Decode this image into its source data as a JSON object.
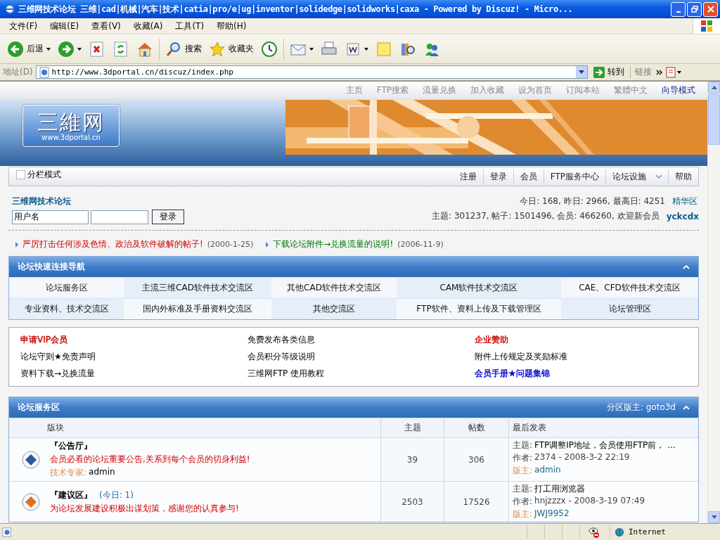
{
  "window": {
    "title": "三维网技术论坛 三维|cad|机械|汽车|技术|catia|pro/e|ug|inventor|solidedge|solidworks|caxa - Powered by Discuz! - Micro..."
  },
  "menu": [
    "文件(F)",
    "编辑(E)",
    "查看(V)",
    "收藏(A)",
    "工具(T)",
    "帮助(H)"
  ],
  "toolbar": [
    {
      "kind": "back",
      "label": "后退",
      "dropdown": true
    },
    {
      "kind": "forward",
      "dropdown": true
    },
    {
      "kind": "stop",
      "dropdown": false
    },
    {
      "kind": "refresh",
      "dropdown": false
    },
    {
      "kind": "home",
      "dropdown": false
    },
    {
      "kind": "search",
      "label": "搜索",
      "dropdown": false
    },
    {
      "kind": "favorites",
      "label": "收藏夹",
      "dropdown": false
    },
    {
      "kind": "history",
      "dropdown": false
    },
    {
      "kind": "mail",
      "dropdown": true
    },
    {
      "kind": "print",
      "dropdown": false
    },
    {
      "kind": "edit",
      "dropdown": true
    },
    {
      "kind": "note",
      "dropdown": false
    },
    {
      "kind": "research",
      "dropdown": false
    },
    {
      "kind": "messenger",
      "dropdown": false
    }
  ],
  "address": {
    "label": "地址(D)",
    "url": "http://www.3dportal.cn/discuz/index.php",
    "go": "转到",
    "links": "链接"
  },
  "top_links": [
    {
      "label": "主页",
      "selected": false
    },
    {
      "label": "FTP搜索",
      "selected": false
    },
    {
      "label": "流量兑换",
      "selected": false
    },
    {
      "label": "加入收藏",
      "selected": false
    },
    {
      "label": "设为首页",
      "selected": false
    },
    {
      "label": "订阅本站",
      "selected": false
    },
    {
      "label": "繁體中文",
      "selected": false
    },
    {
      "label": "向导模式",
      "selected": true
    }
  ],
  "logo": {
    "name": "三維网",
    "url": "www.3dportal.cn"
  },
  "navbar": {
    "split_mode": {
      "label": "分栏模式",
      "checked": false
    },
    "links": [
      {
        "label": "注册",
        "dropdown": false
      },
      {
        "label": "登录",
        "dropdown": false
      },
      {
        "label": "会员",
        "dropdown": false
      },
      {
        "label": "FTP服务中心",
        "dropdown": false
      },
      {
        "label": "论坛设施",
        "dropdown": true
      },
      {
        "label": "帮助",
        "dropdown": false
      }
    ]
  },
  "forum_title": "三维网技术论坛",
  "login": {
    "username": "用户名",
    "button": "登录"
  },
  "stats": [
    {
      "text": "今日: 168, 昨日: 2966, 最高日: 4251",
      "link": "精华区"
    },
    {
      "text": "主题: 301237, 帖子: 1501496, 会员: 466260, 欢迎新会员",
      "link": "yckcdx"
    }
  ],
  "announcements": [
    {
      "text": "严厉打击任何涉及色情、政治及软件破解的帖子!",
      "date": "(2000-1-25)",
      "color": "#cc0000"
    },
    {
      "text": "下载论坛附件→兑换流量的说明!",
      "date": "(2006-11-9)",
      "color": "#007700"
    }
  ],
  "quick_nav": {
    "title": "论坛快速连接导航",
    "items": [
      "论坛服务区",
      "主流三维CAD软件技术交流区",
      "其他CAD软件技术交流区",
      "CAM软件技术交流区",
      "CAE、CFD软件技术交流区",
      "专业资料、技术交流区",
      "国内外标准及手册资料交流区",
      "其他交流区",
      "FTP软件、资料上传及下载管理区",
      "论坛管理区"
    ]
  },
  "links_box": [
    {
      "label": "申请VIP会员",
      "color": "#cc0000"
    },
    {
      "label": "免费发布各类信息"
    },
    {
      "label": "企业赞助",
      "color": "#cc0000"
    },
    {
      "label": "论坛守则★免责声明"
    },
    {
      "label": "会员积分等级说明"
    },
    {
      "label": "附件上传规定及奖励标准"
    },
    {
      "label": "资料下载→兑换流量"
    },
    {
      "label": "三维网FTP 使用教程"
    },
    {
      "label": "会员手册★问题集锦",
      "color": "#0000cc"
    }
  ],
  "forum_section": {
    "title": "论坛服务区",
    "moderator_label": "分区版主:",
    "moderator": "goto3d",
    "columns": [
      "版块",
      "主题",
      "帖数",
      "最后发表"
    ],
    "rows": [
      {
        "color": "#2a5a9a",
        "name": "『公告厅』",
        "desc": "会员必看的论坛重要公告,关系到每个会员的切身利益!",
        "mod_label": "技术专家:",
        "mod": "admin",
        "topics": "39",
        "posts": "306",
        "last": [
          {
            "label": "主题:",
            "value": "FTP调整IP地址，会员使用FTP前， ..."
          },
          {
            "label": "作者:",
            "value": "2374 - 2008-3-2 22:19"
          },
          {
            "label": "版主:",
            "value": "admin"
          }
        ]
      },
      {
        "color": "#e07020",
        "name": "『建议区』",
        "today": "(今日: 1)",
        "desc": "为论坛发展建设积极出谋划策，感谢您的认真参与!",
        "topics": "2503",
        "posts": "17526",
        "last": [
          {
            "label": "主题:",
            "value": "打工用浏览器"
          },
          {
            "label": "作者:",
            "value": "hnjzzzx - 2008-3-19 07:49"
          },
          {
            "label": "版主:",
            "value": "JWJ9952"
          }
        ]
      }
    ]
  },
  "status_bar": {
    "zone": "Internet"
  }
}
